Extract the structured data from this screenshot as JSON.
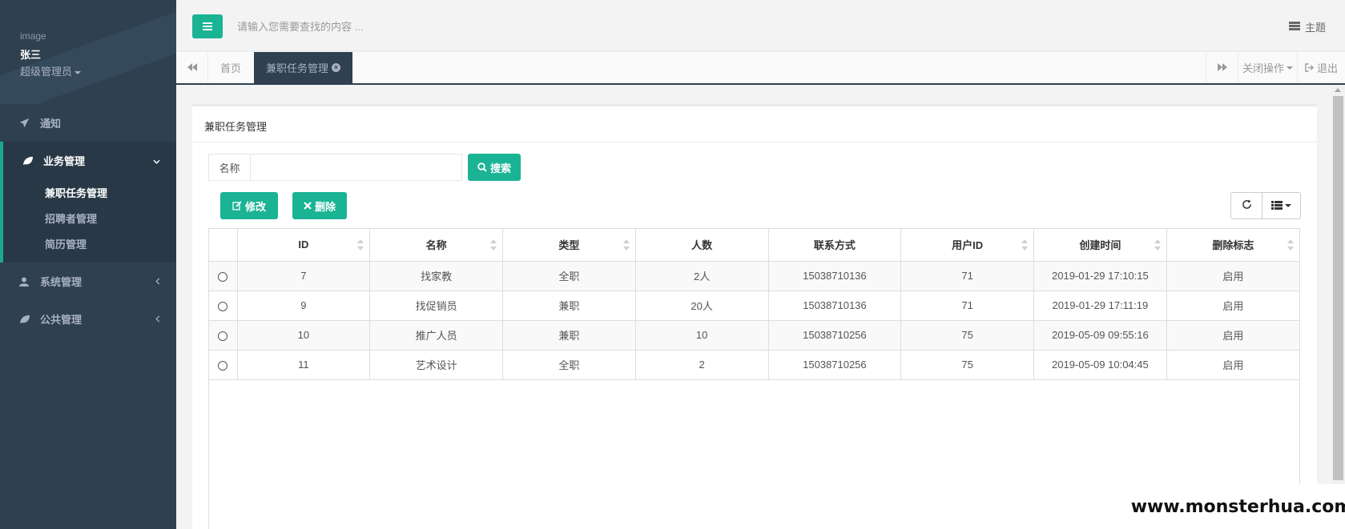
{
  "sidebar": {
    "profile": {
      "image_alt": "image",
      "name": "张三",
      "role": "超级管理员"
    },
    "items": [
      {
        "label": "通知",
        "icon": "paper-plane-icon"
      },
      {
        "label": "业务管理",
        "icon": "leaf-icon",
        "expanded": true,
        "children": [
          {
            "label": "兼职任务管理",
            "active": true
          },
          {
            "label": "招聘者管理"
          },
          {
            "label": "简历管理"
          }
        ]
      },
      {
        "label": "系统管理",
        "icon": "user-icon"
      },
      {
        "label": "公共管理",
        "icon": "leaf-icon"
      }
    ]
  },
  "topbar": {
    "search_placeholder": "请输入您需要查找的内容 ...",
    "theme_label": "主题"
  },
  "tabs": {
    "home": "首页",
    "active": "兼职任务管理",
    "close_ops": "关闭操作",
    "logout": "退出"
  },
  "panel": {
    "title": "兼职任务管理",
    "search_label": "名称",
    "search_value": "",
    "search_button": "搜索",
    "edit_button": "修改",
    "delete_button": "删除"
  },
  "table": {
    "columns": [
      "ID",
      "名称",
      "类型",
      "人数",
      "联系方式",
      "用户ID",
      "创建时间",
      "删除标志"
    ],
    "rows": [
      [
        "7",
        "找家教",
        "全职",
        "2人",
        "15038710136",
        "71",
        "2019-01-29 17:10:15",
        "启用"
      ],
      [
        "9",
        "找促销员",
        "兼职",
        "20人",
        "15038710136",
        "71",
        "2019-01-29 17:11:19",
        "启用"
      ],
      [
        "10",
        "推广人员",
        "兼职",
        "10",
        "15038710256",
        "75",
        "2019-05-09 09:55:16",
        "启用"
      ],
      [
        "11",
        "艺术设计",
        "全职",
        "2",
        "15038710256",
        "75",
        "2019-05-09 10:04:45",
        "启用"
      ]
    ]
  },
  "watermark": "www.monsterhua.com",
  "colors": {
    "sidebar_bg": "#2f4050",
    "accent": "#1ab394"
  }
}
